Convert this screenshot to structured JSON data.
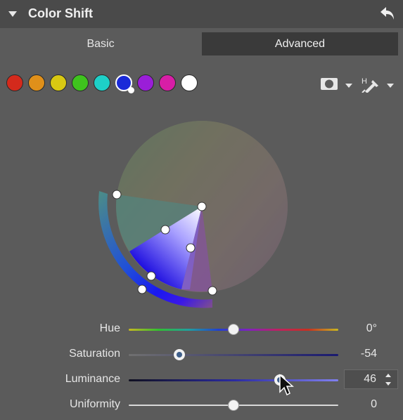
{
  "panel": {
    "title": "Color Shift",
    "collapse_icon": "caret-down-icon",
    "reset_icon": "undo-arrow-icon"
  },
  "tabs": [
    {
      "label": "Basic",
      "active": false
    },
    {
      "label": "Advanced",
      "active": true
    }
  ],
  "swatches": [
    {
      "name": "red",
      "color": "#d42a1c",
      "selected": false
    },
    {
      "name": "orange",
      "color": "#e0901a",
      "selected": false
    },
    {
      "name": "yellow",
      "color": "#d8c812",
      "selected": false
    },
    {
      "name": "green",
      "color": "#3fc41e",
      "selected": false
    },
    {
      "name": "cyan",
      "color": "#1ed0c8",
      "selected": false
    },
    {
      "name": "blue",
      "color": "#1a2ad8",
      "selected": true
    },
    {
      "name": "purple",
      "color": "#9a1ed8",
      "selected": false
    },
    {
      "name": "magenta",
      "color": "#d81ea6",
      "selected": false
    },
    {
      "name": "white",
      "color": "#ffffff",
      "selected": false
    }
  ],
  "tools": [
    {
      "name": "mask-preview-icon"
    },
    {
      "name": "eyedropper-hue-icon",
      "letter": "H"
    }
  ],
  "sliders": [
    {
      "label": "Hue",
      "value": "0°",
      "position": 0.5
    },
    {
      "label": "Saturation",
      "value": "-54",
      "position": 0.24
    },
    {
      "label": "Luminance",
      "value": "46",
      "position": 0.72
    },
    {
      "label": "Uniformity",
      "value": "0",
      "position": 0.5
    }
  ]
}
